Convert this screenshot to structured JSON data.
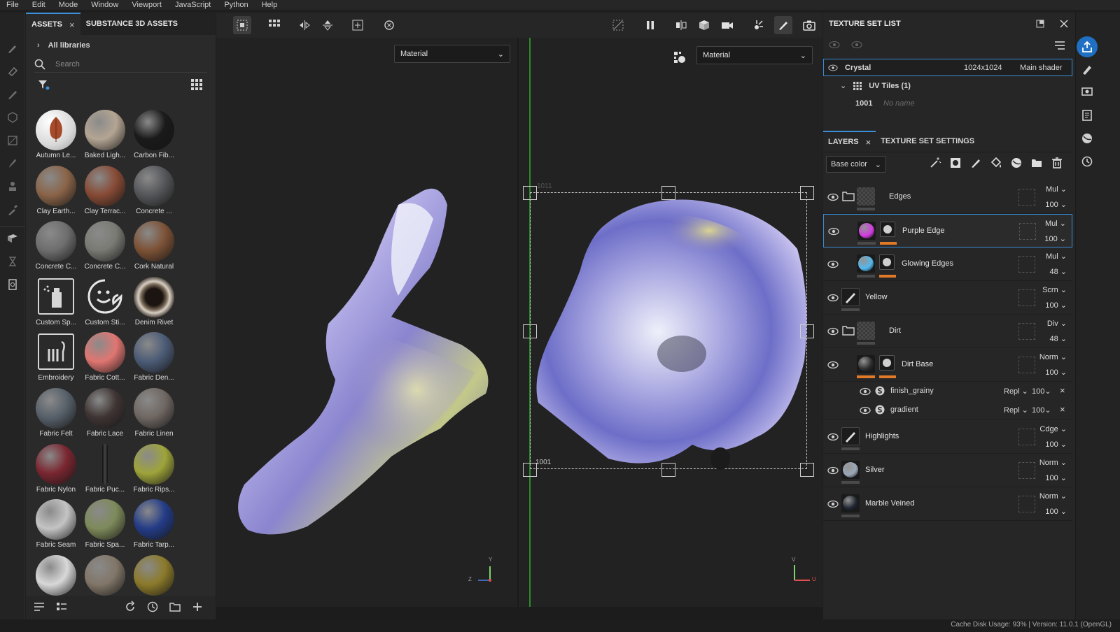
{
  "menu": [
    "File",
    "Edit",
    "Mode",
    "Window",
    "Viewport",
    "JavaScript",
    "Python",
    "Help"
  ],
  "assets": {
    "tab_active": "ASSETS",
    "tab_other": "SUBSTANCE 3D ASSETS",
    "libraries": "All libraries",
    "search_placeholder": "Search",
    "items": [
      {
        "label": "Autumn Le...",
        "kind": "leaf"
      },
      {
        "label": "Baked Ligh...",
        "color": "#b4a593"
      },
      {
        "label": "Carbon Fib...",
        "color": "#1a1a1a"
      },
      {
        "label": "Clay Earth...",
        "color": "#8a6448"
      },
      {
        "label": "Clay Terrac...",
        "color": "#874a35"
      },
      {
        "label": "Concrete ...",
        "color": "#55565a"
      },
      {
        "label": "Concrete C...",
        "color": "#6e6e6e"
      },
      {
        "label": "Concrete C...",
        "color": "#7a7a74"
      },
      {
        "label": "Cork Natural",
        "color": "#7d5236"
      },
      {
        "label": "Custom Sp...",
        "kind": "spray"
      },
      {
        "label": "Custom Sti...",
        "kind": "sticker"
      },
      {
        "label": "Denim Rivet",
        "kind": "rivet"
      },
      {
        "label": "Embroidery",
        "kind": "embroidery"
      },
      {
        "label": "Fabric Cott...",
        "color": "#e07672"
      },
      {
        "label": "Fabric Den...",
        "color": "#4c5c76"
      },
      {
        "label": "Fabric Felt",
        "color": "#57606a"
      },
      {
        "label": "Fabric Lace",
        "color": "#3e3433"
      },
      {
        "label": "Fabric Linen",
        "color": "#6f6762"
      },
      {
        "label": "Fabric Nylon",
        "color": "#7a2630"
      },
      {
        "label": "Fabric Puc...",
        "kind": "thin"
      },
      {
        "label": "Fabric Rips...",
        "color": "#9ea43a"
      },
      {
        "label": "Fabric Seam",
        "color": "#c4c4c4"
      },
      {
        "label": "Fabric Spa...",
        "color": "#7d8a5a"
      },
      {
        "label": "Fabric Tarp...",
        "color": "#243c88"
      },
      {
        "label": "",
        "color": "#d8d8d8"
      },
      {
        "label": "",
        "color": "#817668"
      },
      {
        "label": "",
        "color": "#8b7a2a"
      }
    ]
  },
  "viewport": {
    "left_channel": "Material",
    "right_channel": "Material",
    "uv_tile_top": "1011",
    "uv_tile_bottom": "1001",
    "axis_left": {
      "y": "Y",
      "z": "Z"
    },
    "axis_right": {
      "v": "V",
      "u": "U"
    }
  },
  "texture_set_list": {
    "title": "TEXTURE SET LIST",
    "set_name": "Crystal",
    "resolution": "1024x1024",
    "shader": "Main shader",
    "uv_tiles": "UV Tiles (1)",
    "tile_id": "1001",
    "tile_name": "No name"
  },
  "layers_panel": {
    "tab_layers": "LAYERS",
    "tab_settings": "TEXTURE SET SETTINGS",
    "channel": "Base color",
    "layers": [
      {
        "name": "Edges",
        "type": "folder",
        "blend": "Mul",
        "opacity": "100"
      },
      {
        "name": "Purple Edge",
        "type": "fill",
        "color": "#d33be0",
        "blend": "Mul",
        "opacity": "100",
        "selected": true
      },
      {
        "name": "Glowing Edges",
        "type": "fill",
        "color": "#52b8ef",
        "blend": "Mul",
        "opacity": "48"
      },
      {
        "name": "Yellow",
        "type": "paint",
        "blend": "Scrn",
        "opacity": "100"
      },
      {
        "name": "Dirt",
        "type": "folder",
        "blend": "Div",
        "opacity": "48"
      },
      {
        "name": "Dirt Base",
        "type": "fill",
        "color": "#2c2c2c",
        "blend": "Norm",
        "opacity": "100"
      },
      {
        "name": "Highlights",
        "type": "paint",
        "blend": "Cdge",
        "opacity": "100"
      },
      {
        "name": "Silver",
        "type": "fill",
        "color": "#9aa7b8",
        "blend": "Norm",
        "opacity": "100"
      },
      {
        "name": "Marble Veined",
        "type": "fill",
        "color": "#1f2430",
        "blend": "Norm",
        "opacity": "100"
      }
    ],
    "effects": [
      {
        "name": "finish_grainy",
        "blend": "Repl",
        "opacity": "100"
      },
      {
        "name": "gradient",
        "blend": "Repl",
        "opacity": "100"
      }
    ]
  },
  "status": "Cache Disk Usage: 93% | Version: 11.0.1 (OpenGL)"
}
